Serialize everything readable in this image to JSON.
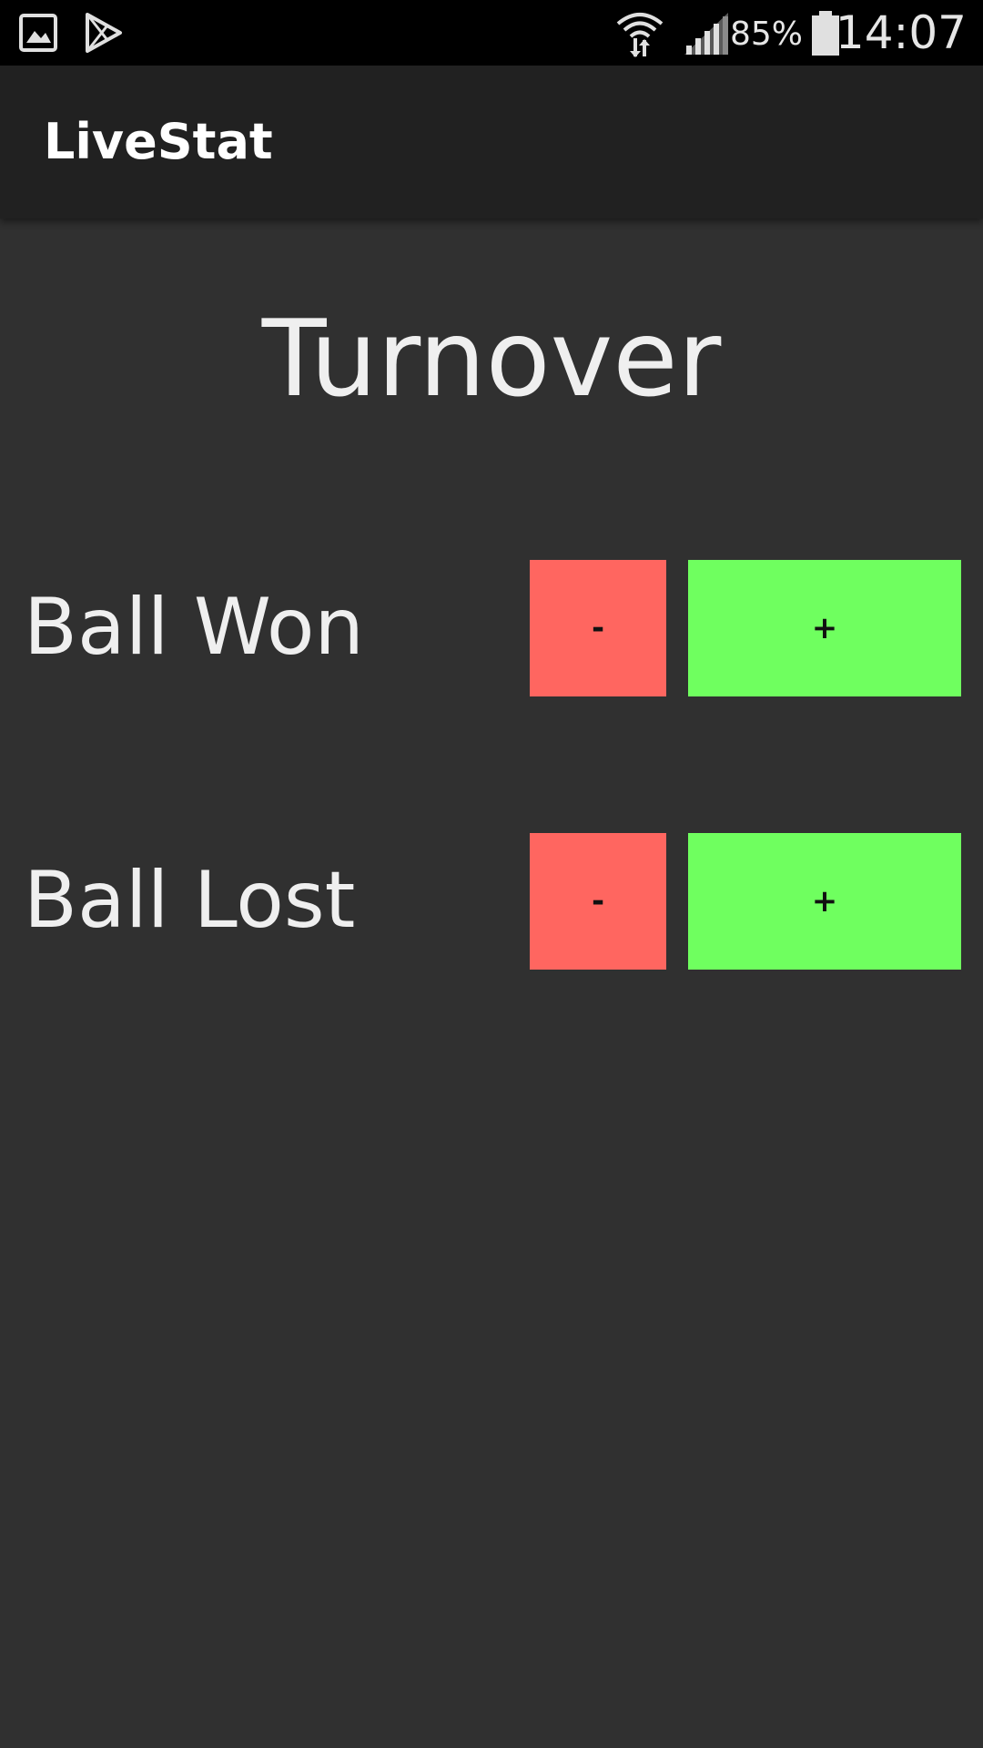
{
  "status_bar": {
    "battery_percent": "85%",
    "time": "14:07",
    "icons": [
      "gallery-icon",
      "play-store-icon",
      "wifi-icon",
      "signal-icon",
      "battery-icon"
    ]
  },
  "app_bar": {
    "title": "LiveStat"
  },
  "main": {
    "heading": "Turnover",
    "stats": [
      {
        "label": "Ball Won",
        "decrement_label": "-",
        "increment_label": "+"
      },
      {
        "label": "Ball Lost",
        "decrement_label": "-",
        "increment_label": "+"
      }
    ]
  },
  "colors": {
    "background": "#303030",
    "app_bar": "#212121",
    "decrement": "#ff6660",
    "increment": "#6fff5f"
  }
}
